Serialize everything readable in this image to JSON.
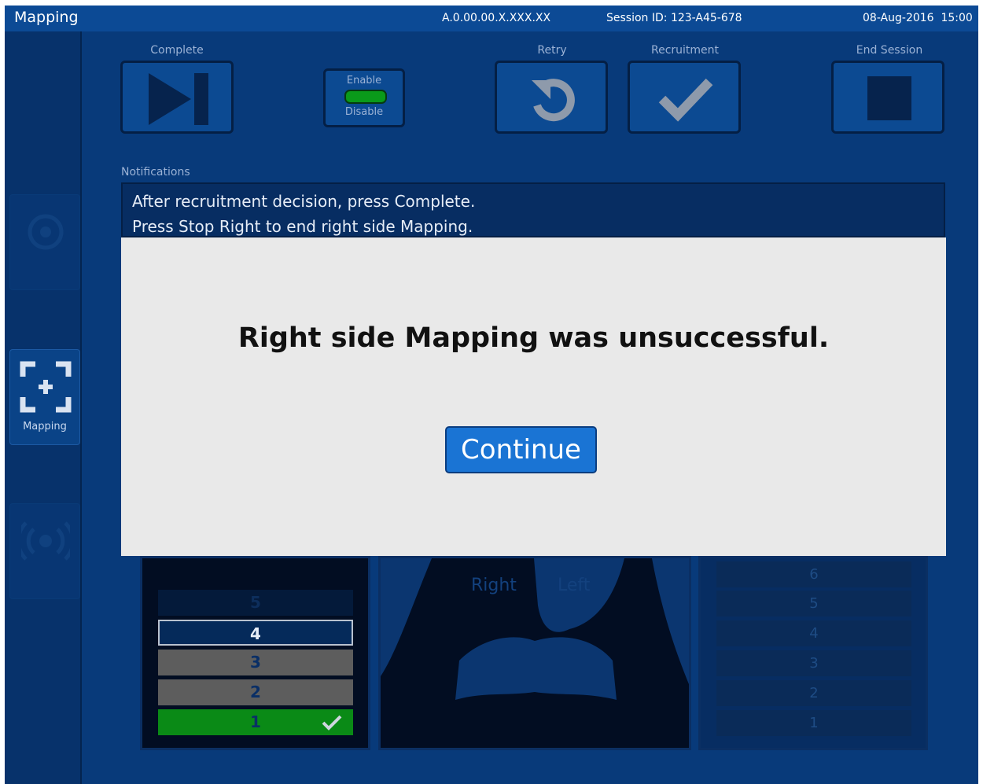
{
  "header": {
    "app_title": "Mapping",
    "version": "A.0.00.00.X.XXX.XX",
    "session": "Session ID: 123-A45-678",
    "datetime": "08-Aug-2016  15:00"
  },
  "sidebar": {
    "mapping_label": "Mapping"
  },
  "toolbar": {
    "complete_label": "Complete",
    "enable_label": "Enable",
    "disable_label": "Disable",
    "retry_label": "Retry",
    "recruitment_label": "Recruitment",
    "end_session_label": "End Session"
  },
  "notifications": {
    "label": "Notifications",
    "lines": [
      "After recruitment decision, press Complete.",
      "Press Stop Right to end right side Mapping."
    ]
  },
  "left_levels": [
    "5",
    "4",
    "3",
    "2",
    "1"
  ],
  "lung": {
    "right_label": "Right",
    "left_label": "Left"
  },
  "right_levels": [
    "6",
    "5",
    "4",
    "3",
    "2",
    "1"
  ],
  "modal": {
    "message": "Right side Mapping was unsuccessful.",
    "button_label": "Continue"
  },
  "colors": {
    "accent": "#1a74d4",
    "background": "#083a7a",
    "topbar": "#0c4a95",
    "success": "#0a8a16"
  }
}
